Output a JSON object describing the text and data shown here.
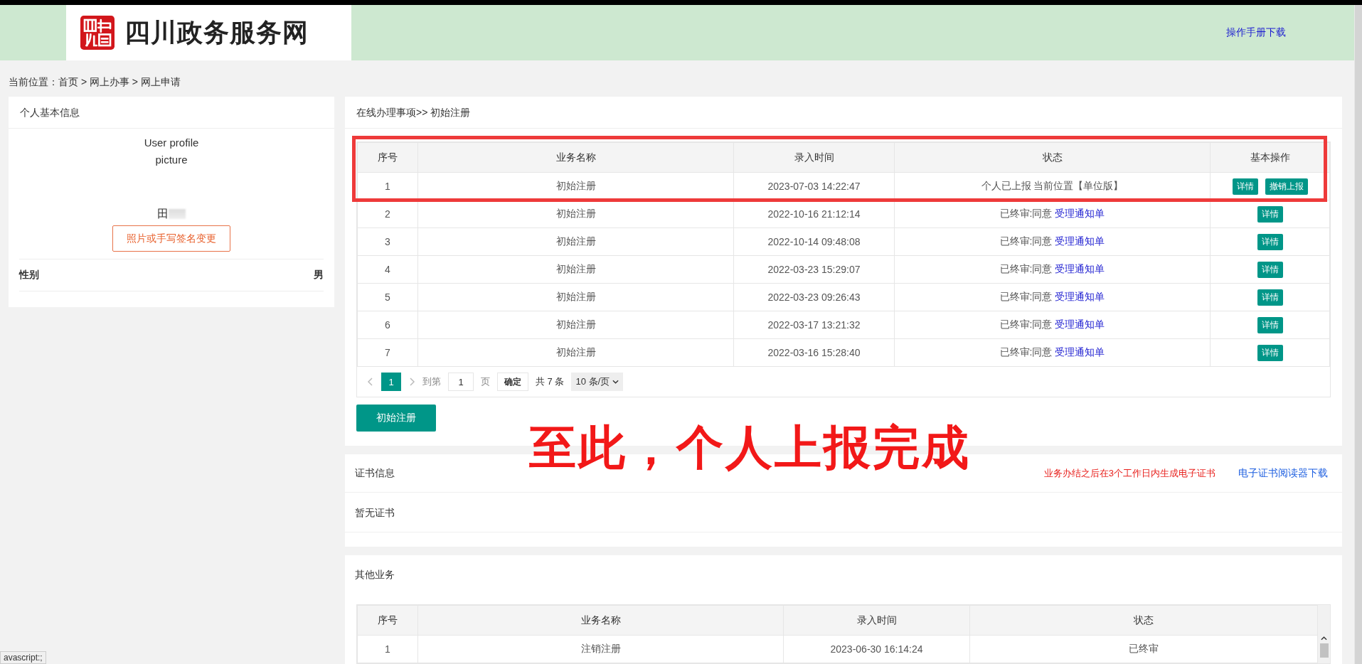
{
  "header": {
    "site_name": "四川政务服务网",
    "manual_link": "操作手册下载"
  },
  "breadcrumb": "当前位置：首页 > 网上办事 > 网上申请",
  "profile": {
    "title": "个人基本信息",
    "picture_alt": "User profile picture",
    "name": "田",
    "change_button": "照片或手写签名变更",
    "fields": [
      {
        "label": "性别",
        "value": "男"
      }
    ]
  },
  "applications": {
    "title": "在线办理事项>> 初始注册",
    "columns": [
      "序号",
      "业务名称",
      "录入时间",
      "状态",
      "基本操作"
    ],
    "rows": [
      {
        "index": "1",
        "name": "初始注册",
        "time": "2023-07-03 14:22:47",
        "status": "个人已上报 当前位置【单位版】",
        "highlighted": true,
        "actions": [
          "详情",
          "撤销上报"
        ]
      },
      {
        "index": "2",
        "name": "初始注册",
        "time": "2022-10-16 21:12:14",
        "status": "已终审:同意",
        "status_link": "受理通知单",
        "highlighted": false,
        "actions": [
          "详情"
        ]
      },
      {
        "index": "3",
        "name": "初始注册",
        "time": "2022-10-14 09:48:08",
        "status": "已终审:同意",
        "status_link": "受理通知单",
        "highlighted": false,
        "actions": [
          "详情"
        ]
      },
      {
        "index": "4",
        "name": "初始注册",
        "time": "2022-03-23 15:29:07",
        "status": "已终审:同意",
        "status_link": "受理通知单",
        "highlighted": false,
        "actions": [
          "详情"
        ]
      },
      {
        "index": "5",
        "name": "初始注册",
        "time": "2022-03-23 09:26:43",
        "status": "已终审:同意",
        "status_link": "受理通知单",
        "highlighted": false,
        "actions": [
          "详情"
        ]
      },
      {
        "index": "6",
        "name": "初始注册",
        "time": "2022-03-17 13:21:32",
        "status": "已终审:同意",
        "status_link": "受理通知单",
        "highlighted": false,
        "actions": [
          "详情"
        ]
      },
      {
        "index": "7",
        "name": "初始注册",
        "time": "2022-03-16 15:28:40",
        "status": "已终审:同意",
        "status_link": "受理通知单",
        "highlighted": false,
        "actions": [
          "详情"
        ]
      }
    ],
    "pagination": {
      "current_page": "1",
      "goto_label": "到第",
      "page_input": "1",
      "page_label": "页",
      "confirm": "确定",
      "total": "共 7 条",
      "page_size": "10 条/页"
    },
    "new_button": "初始注册"
  },
  "caption": "至此，个人上报完成",
  "certificates": {
    "title": "证书信息",
    "notice": "业务办结之后在3个工作日内生成电子证书",
    "reader_link": "电子证书阅读器下载",
    "empty_text": "暂无证书"
  },
  "other_business": {
    "title": "其他业务",
    "columns": [
      "序号",
      "业务名称",
      "录入时间",
      "状态"
    ],
    "rows": [
      {
        "index": "1",
        "name": "注销注册",
        "time": "2023-06-30 16:14:24",
        "status": "已终审"
      }
    ]
  },
  "status_bar": "avascript:;"
}
